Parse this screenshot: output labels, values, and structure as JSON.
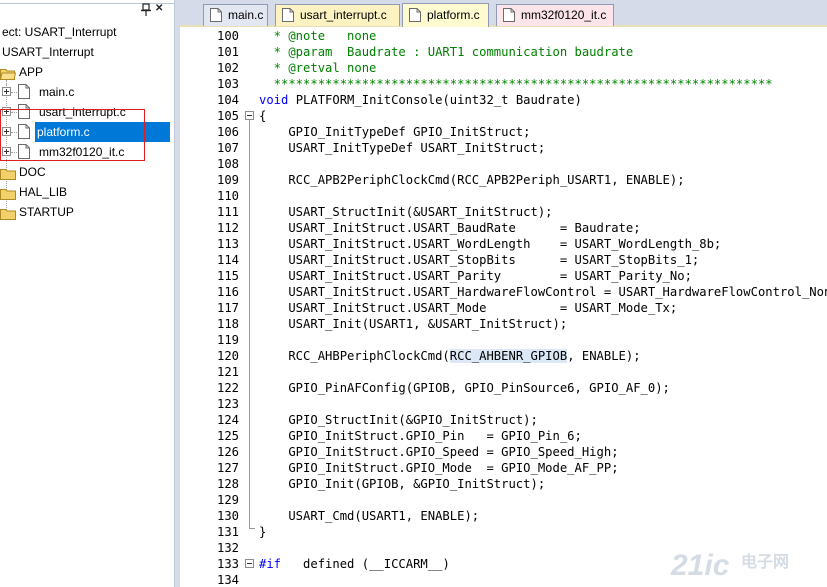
{
  "project_panel": {
    "project_title": "ect: USART_Interrupt",
    "root_label": "USART_Interrupt",
    "groups": [
      {
        "label": "APP",
        "files": [
          "main.c",
          "usart_interrupt.c",
          "platform.c",
          "mm32f0120_it.c"
        ]
      },
      {
        "label": "DOC"
      },
      {
        "label": "HAL_LIB"
      },
      {
        "label": "STARTUP"
      }
    ],
    "selected_file": "platform.c"
  },
  "tabs": [
    {
      "label": "main.c"
    },
    {
      "label": "usart_interrupt.c"
    },
    {
      "label": "platform.c",
      "active": true
    },
    {
      "label": "mm32f0120_it.c"
    }
  ],
  "editor": {
    "line_numbers": [
      "100",
      "101",
      "102",
      "103",
      "104",
      "105",
      "106",
      "107",
      "108",
      "109",
      "110",
      "111",
      "112",
      "113",
      "114",
      "115",
      "116",
      "117",
      "118",
      "119",
      "120",
      "121",
      "122",
      "123",
      "124",
      "125",
      "126",
      "127",
      "128",
      "129",
      "130",
      "131",
      "132",
      "133",
      "134"
    ],
    "lines": [
      "  * @note   none",
      "  * @param  Baudrate : UART1 communication baudrate",
      "  * @retval none",
      "  ********************************************************************",
      "void PLATFORM_InitConsole(uint32_t Baudrate)",
      "{",
      "    GPIO_InitTypeDef GPIO_InitStruct;",
      "    USART_InitTypeDef USART_InitStruct;",
      "",
      "    RCC_APB2PeriphClockCmd(RCC_APB2Periph_USART1, ENABLE);",
      "",
      "    USART_StructInit(&USART_InitStruct);",
      "    USART_InitStruct.USART_BaudRate      = Baudrate;",
      "    USART_InitStruct.USART_WordLength    = USART_WordLength_8b;",
      "    USART_InitStruct.USART_StopBits      = USART_StopBits_1;",
      "    USART_InitStruct.USART_Parity        = USART_Parity_No;",
      "    USART_InitStruct.USART_HardwareFlowControl = USART_HardwareFlowControl_None;",
      "    USART_InitStruct.USART_Mode          = USART_Mode_Tx;",
      "    USART_Init(USART1, &USART_InitStruct);",
      "",
      "    RCC_AHBPeriphClockCmd(RCC_AHBENR_GPIOB, ENABLE);",
      "",
      "    GPIO_PinAFConfig(GPIOB, GPIO_PinSource6, GPIO_AF_0);",
      "",
      "    GPIO_StructInit(&GPIO_InitStruct);",
      "    GPIO_InitStruct.GPIO_Pin   = GPIO_Pin_6;",
      "    GPIO_InitStruct.GPIO_Speed = GPIO_Speed_High;",
      "    GPIO_InitStruct.GPIO_Mode  = GPIO_Mode_AF_PP;",
      "    GPIO_Init(GPIOB, &GPIO_InitStruct);",
      "",
      "    USART_Cmd(USART1, ENABLE);",
      "}",
      "",
      "#if   defined (__ICCARM__)",
      ""
    ]
  },
  "watermark": {
    "text": "21ic",
    "subtext": "电子网"
  },
  "colors": {
    "selection": "#0078d7",
    "comment": "#008000",
    "keyword": "#0000ff",
    "highlight_box": "#e02020"
  }
}
